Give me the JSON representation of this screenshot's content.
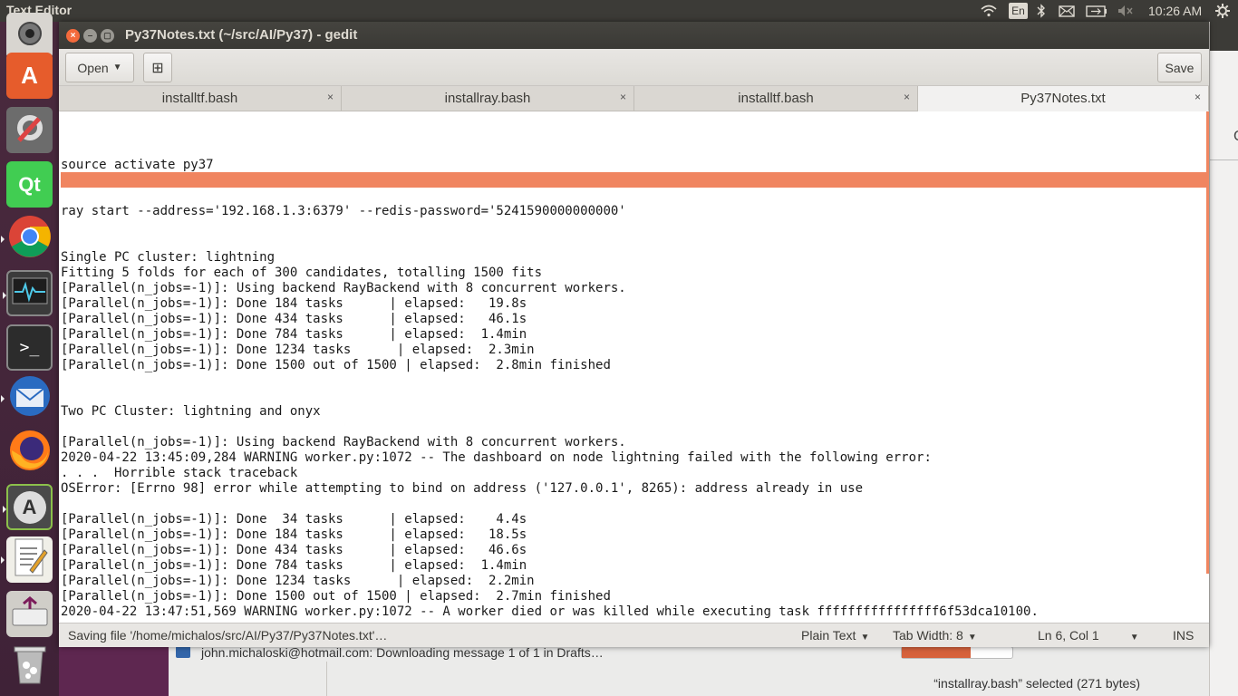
{
  "topbar": {
    "app_name": "Text Editor",
    "keyboard_layout": "En",
    "clock": "10:26 AM"
  },
  "launcher": {
    "items": [
      {
        "name": "webcam-app"
      },
      {
        "name": "ubuntu-software",
        "letter": "A"
      },
      {
        "name": "system-settings"
      },
      {
        "name": "qt-creator",
        "letter": "Qt"
      },
      {
        "name": "chrome"
      },
      {
        "name": "system-monitor"
      },
      {
        "name": "terminal",
        "letter": ">_"
      },
      {
        "name": "thunderbird"
      },
      {
        "name": "firefox"
      },
      {
        "name": "software-updater",
        "letter": "A"
      },
      {
        "name": "text-editor"
      },
      {
        "name": "usb-creator"
      },
      {
        "name": "trash"
      }
    ]
  },
  "window": {
    "title": "Py37Notes.txt (~/src/AI/Py37) - gedit",
    "close_glyph": "×",
    "minimize_glyph": "–",
    "maximize_glyph": "▢"
  },
  "toolbar": {
    "open_label": "Open",
    "new_tab_glyph": "⊞",
    "save_label": "Save"
  },
  "tabs": [
    {
      "label": "installtf.bash",
      "close": "×",
      "active": false
    },
    {
      "label": "installray.bash",
      "close": "×",
      "active": false
    },
    {
      "label": "installtf.bash",
      "close": "×",
      "active": false
    },
    {
      "label": "Py37Notes.txt",
      "close": "×",
      "active": true
    }
  ],
  "editor": {
    "lines": [
      "",
      "",
      "",
      "source activate py37",
      "",
      "",
      "ray start --address='192.168.1.3:6379' --redis-password='5241590000000000'",
      "",
      "",
      "Single PC cluster: lightning",
      "Fitting 5 folds for each of 300 candidates, totalling 1500 fits",
      "[Parallel(n_jobs=-1)]: Using backend RayBackend with 8 concurrent workers.",
      "[Parallel(n_jobs=-1)]: Done 184 tasks      | elapsed:   19.8s",
      "[Parallel(n_jobs=-1)]: Done 434 tasks      | elapsed:   46.1s",
      "[Parallel(n_jobs=-1)]: Done 784 tasks      | elapsed:  1.4min",
      "[Parallel(n_jobs=-1)]: Done 1234 tasks      | elapsed:  2.3min",
      "[Parallel(n_jobs=-1)]: Done 1500 out of 1500 | elapsed:  2.8min finished",
      "",
      "",
      "Two PC Cluster: lightning and onyx",
      "",
      "[Parallel(n_jobs=-1)]: Using backend RayBackend with 8 concurrent workers.",
      "2020-04-22 13:45:09,284 WARNING worker.py:1072 -- The dashboard on node lightning failed with the following error:",
      ". . .  Horrible stack traceback",
      "OSError: [Errno 98] error while attempting to bind on address ('127.0.0.1', 8265): address already in use",
      "",
      "[Parallel(n_jobs=-1)]: Done  34 tasks      | elapsed:    4.4s",
      "[Parallel(n_jobs=-1)]: Done 184 tasks      | elapsed:   18.5s",
      "[Parallel(n_jobs=-1)]: Done 434 tasks      | elapsed:   46.6s",
      "[Parallel(n_jobs=-1)]: Done 784 tasks      | elapsed:  1.4min",
      "[Parallel(n_jobs=-1)]: Done 1234 tasks      | elapsed:  2.2min",
      "[Parallel(n_jobs=-1)]: Done 1500 out of 1500 | elapsed:  2.7min finished",
      "2020-04-22 13:47:51,569 WARNING worker.py:1072 -- A worker died or was killed while executing task ffffffffffffffff6f53dca10100."
    ]
  },
  "statusbar": {
    "message": "Saving file '/home/michalos/src/AI/Py37/Py37Notes.txt'…",
    "language": "Plain Text",
    "tab_width": "Tab Width: 8",
    "position": "Ln 6, Col 1",
    "insert_mode": "INS"
  },
  "background": {
    "mail_status": "john.michaloski@hotmail.com: Downloading message 1 of 1 in Drafts…",
    "mail_progress": 0.62,
    "files_selection": "“installray.bash” selected  (271 bytes)",
    "right_window_glyph": "C"
  },
  "colors": {
    "accent": "#f08560",
    "panel": "#3c3b37",
    "launcher": "#4a2a3e"
  }
}
